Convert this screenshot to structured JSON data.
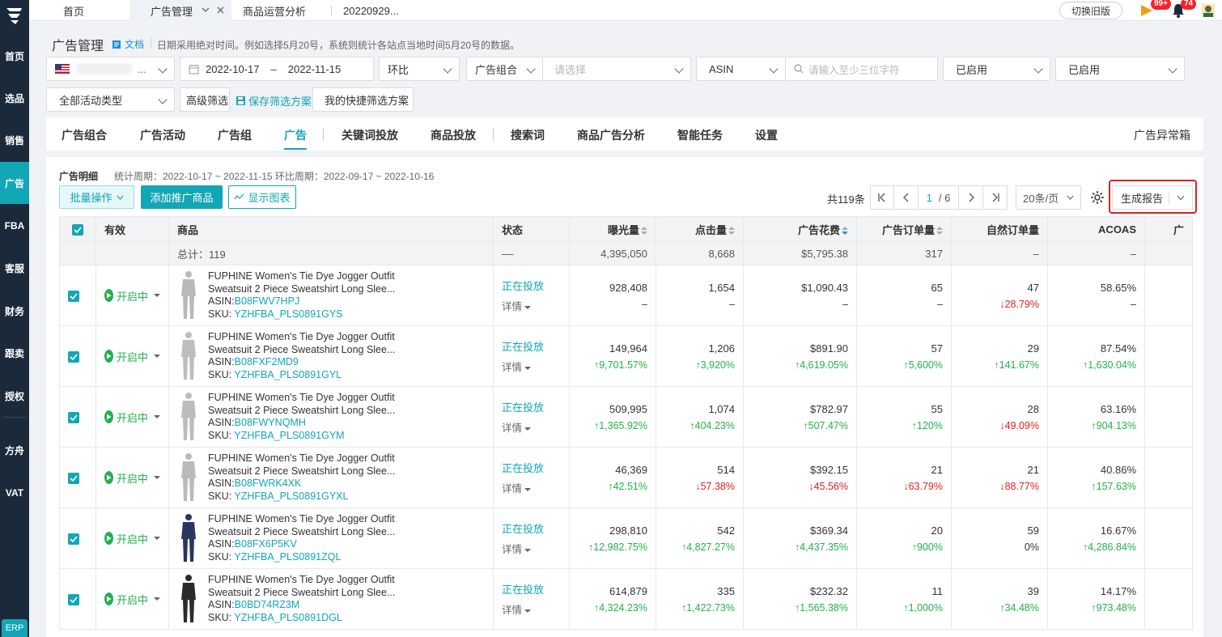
{
  "sidebar": {
    "items": [
      "首页",
      "选品",
      "销售",
      "广告",
      "FBA",
      "客服",
      "财务",
      "跟卖",
      "授权",
      "方舟",
      "VAT"
    ],
    "active": "广告",
    "erp_label": "ERP"
  },
  "topbar": {
    "tabs": [
      "首页",
      "广告管理",
      "商品运营分析",
      "20220929..."
    ],
    "switch_label": "切换旧版",
    "badge_flag": "99+",
    "badge_bell": "74"
  },
  "header": {
    "title": "广告管理",
    "doc_label": "文档",
    "hint": "日期采用绝对时间。例如选择5月20号，系统则统计各站点当地时间5月20号的数据。"
  },
  "filters": {
    "date_start": "2022-10-17",
    "date_sep": "–",
    "date_end": "2022-11-15",
    "compare": "环比",
    "group_type": "广告组合",
    "group_placeholder": "请选择",
    "search_type": "ASIN",
    "search_placeholder": "请输入至少三位字符",
    "status1": "已启用",
    "status2": "已启用",
    "activity_type": "全部活动类型",
    "advanced": "高级筛选",
    "save_scheme": "保存筛选方案",
    "my_scheme": "我的快捷筛选方案"
  },
  "main_tabs": [
    "广告组合",
    "广告活动",
    "广告组",
    "广告",
    "关键词投放",
    "商品投放",
    "搜索词",
    "商品广告分析",
    "智能任务",
    "设置"
  ],
  "main_tab_active": "广告",
  "anomaly_box": "广告异常箱",
  "detail": {
    "label": "广告明细",
    "period": "统计周期：2022-10-17 ~ 2022-11-15 环比周期：2022-09-17 ~ 2022-10-16"
  },
  "toolbar": {
    "batch": "批量操作",
    "add": "添加推广商品",
    "show_chart": "显示图表",
    "total": "共119条",
    "page_current": "1",
    "page_total": "/ 6",
    "page_size": "20条/页",
    "report": "生成报告"
  },
  "table": {
    "headers": [
      "有效",
      "商品",
      "状态",
      "曝光量",
      "点击量",
      "广告花费",
      "广告订单量",
      "自然订单量",
      "ACOAS",
      "广"
    ],
    "total_row": {
      "label": "总计：119",
      "status": "––",
      "impressions": "4,395,050",
      "clicks": "8,668",
      "spend": "$5,795.38",
      "ad_orders": "317",
      "organic_orders": "–",
      "acoas": "–"
    },
    "rows": [
      {
        "state": "开启中",
        "title1": "FUPHINE Women's Tie Dye Jogger Outfit",
        "title2": "Sweatsuit 2 Piece Sweatshirt Long Slee...",
        "asin_label": "ASIN:",
        "asin": "B08FWV7HPJ",
        "sku_label": "SKU: ",
        "sku": "YZHFBA_PLS0891GYS",
        "status": "正在投放",
        "detail": "详情",
        "impressions": "928,408",
        "impressions_chg": "–",
        "clicks": "1,654",
        "clicks_chg": "–",
        "spend": "$1,090.43",
        "spend_chg": "–",
        "ad_orders": "65",
        "ad_orders_chg": "–",
        "organic": "47",
        "organic_chg": "↓28.79%",
        "acoas": "58.65%",
        "acoas_chg": "–"
      },
      {
        "state": "开启中",
        "title1": "FUPHINE Women's Tie Dye Jogger Outfit",
        "title2": "Sweatsuit 2 Piece Sweatshirt Long Slee...",
        "asin_label": "ASIN:",
        "asin": "B08FXF2MD9",
        "sku_label": "SKU: ",
        "sku": "YZHFBA_PLS0891GYL",
        "status": "正在投放",
        "detail": "详情",
        "impressions": "149,964",
        "impressions_chg": "↑9,701.57%",
        "clicks": "1,206",
        "clicks_chg": "↑3,920%",
        "spend": "$891.90",
        "spend_chg": "↑4,619.05%",
        "ad_orders": "57",
        "ad_orders_chg": "↑5,600%",
        "organic": "29",
        "organic_chg": "↑141.67%",
        "acoas": "87.54%",
        "acoas_chg": "↑1,630.04%"
      },
      {
        "state": "开启中",
        "title1": "FUPHINE Women's Tie Dye Jogger Outfit",
        "title2": "Sweatsuit 2 Piece Sweatshirt Long Slee...",
        "asin_label": "ASIN:",
        "asin": "B08FWYNQMH",
        "sku_label": "SKU: ",
        "sku": "YZHFBA_PLS0891GYM",
        "status": "正在投放",
        "detail": "详情",
        "impressions": "509,995",
        "impressions_chg": "↑1,365.92%",
        "clicks": "1,074",
        "clicks_chg": "↑404.23%",
        "spend": "$782.97",
        "spend_chg": "↑507.47%",
        "ad_orders": "55",
        "ad_orders_chg": "↑120%",
        "organic": "28",
        "organic_chg": "↓49.09%",
        "acoas": "63.16%",
        "acoas_chg": "↑904.13%"
      },
      {
        "state": "开启中",
        "title1": "FUPHINE Women's Tie Dye Jogger Outfit",
        "title2": "Sweatsuit 2 Piece Sweatshirt Long Slee...",
        "asin_label": "ASIN:",
        "asin": "B08FWRK4XK",
        "sku_label": "SKU: ",
        "sku": "YZHFBA_PLS0891GYXL",
        "status": "正在投放",
        "detail": "详情",
        "impressions": "46,369",
        "impressions_chg": "↑42.51%",
        "clicks": "514",
        "clicks_chg": "↓57.38%",
        "spend": "$392.15",
        "spend_chg": "↓45.56%",
        "ad_orders": "21",
        "ad_orders_chg": "↓63.79%",
        "organic": "21",
        "organic_chg": "↓88.77%",
        "acoas": "40.86%",
        "acoas_chg": "↑157.63%"
      },
      {
        "state": "开启中",
        "title1": "FUPHINE Women's Tie Dye Jogger Outfit",
        "title2": "Sweatsuit 2 Piece Sweatshirt Long Slee...",
        "asin_label": "ASIN:",
        "asin": "B08FX6P5KV",
        "sku_label": "SKU: ",
        "sku": "YZHFBA_PLS0891ZQL",
        "status": "正在投放",
        "detail": "详情",
        "impressions": "298,810",
        "impressions_chg": "↑12,982.75%",
        "clicks": "542",
        "clicks_chg": "↑4,827.27%",
        "spend": "$369.34",
        "spend_chg": "↑4,437.35%",
        "ad_orders": "20",
        "ad_orders_chg": "↑900%",
        "organic": "59",
        "organic_chg": "0%",
        "acoas": "16.67%",
        "acoas_chg": "↑4,286.84%"
      },
      {
        "state": "开启中",
        "title1": "FUPHINE Women's Tie Dye Jogger Outfit",
        "title2": "Sweatsuit 2 Piece Sweatshirt Long Slee...",
        "asin_label": "ASIN:",
        "asin": "B0BD74RZ3M",
        "sku_label": "SKU: ",
        "sku": "YZHFBA_PLS0891DGL",
        "status": "正在投放",
        "detail": "详情",
        "impressions": "614,879",
        "impressions_chg": "↑4,324.23%",
        "clicks": "335",
        "clicks_chg": "↑1,422.73%",
        "spend": "$232.32",
        "spend_chg": "↑1,565.38%",
        "ad_orders": "11",
        "ad_orders_chg": "↑1,000%",
        "organic": "39",
        "organic_chg": "↑34.48%",
        "acoas": "14.17%",
        "acoas_chg": "↑973.48%"
      }
    ]
  },
  "colors": {
    "accent": "#12a6b6",
    "sidebar": "#1b2a3a",
    "up": "#23b14d",
    "down": "#e02020",
    "highlight": "#e02020"
  }
}
